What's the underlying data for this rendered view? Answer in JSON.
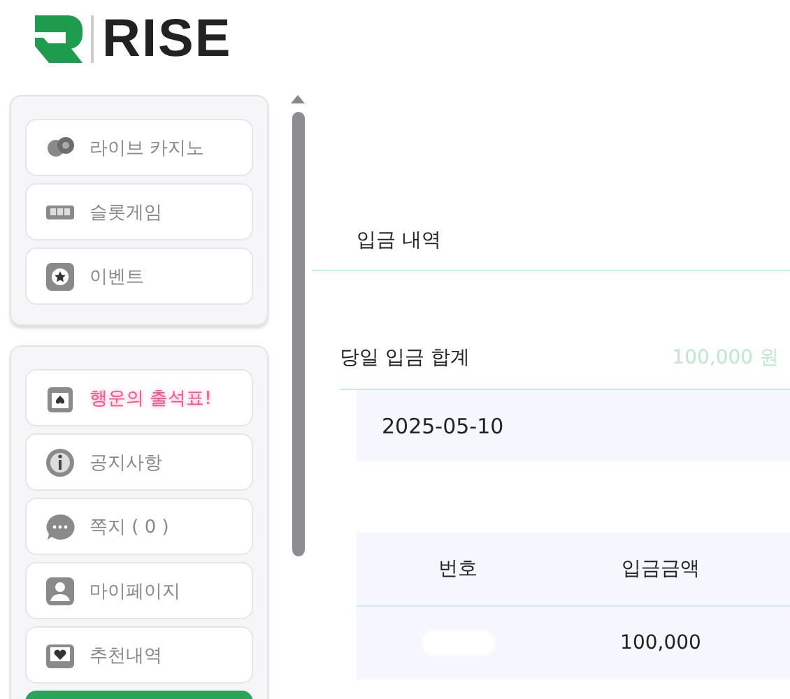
{
  "logo": {
    "text": "RISE"
  },
  "sidebar": {
    "groups": [
      {
        "items": [
          {
            "label": "라이브 카지노",
            "kind": "normal"
          },
          {
            "label": "슬롯게임",
            "kind": "normal"
          },
          {
            "label": "이벤트",
            "kind": "normal"
          }
        ]
      },
      {
        "items": [
          {
            "label": "행운의 출석표!",
            "kind": "highlight"
          },
          {
            "label": "공지사항",
            "kind": "normal"
          },
          {
            "label": "쪽지 ( 0 )",
            "kind": "normal"
          },
          {
            "label": "마이페이지",
            "kind": "normal"
          },
          {
            "label": "추천내역",
            "kind": "normal"
          }
        ]
      }
    ]
  },
  "main": {
    "title": "입금 내역",
    "summary": {
      "label": "당일 입금 합계",
      "amount": "100,000 원"
    },
    "date": "2025-05-10",
    "table": {
      "columns": [
        "번호",
        "입금금액"
      ],
      "rows": [
        {
          "cells": [
            "",
            "100,000"
          ],
          "redacted": true
        }
      ]
    }
  }
}
